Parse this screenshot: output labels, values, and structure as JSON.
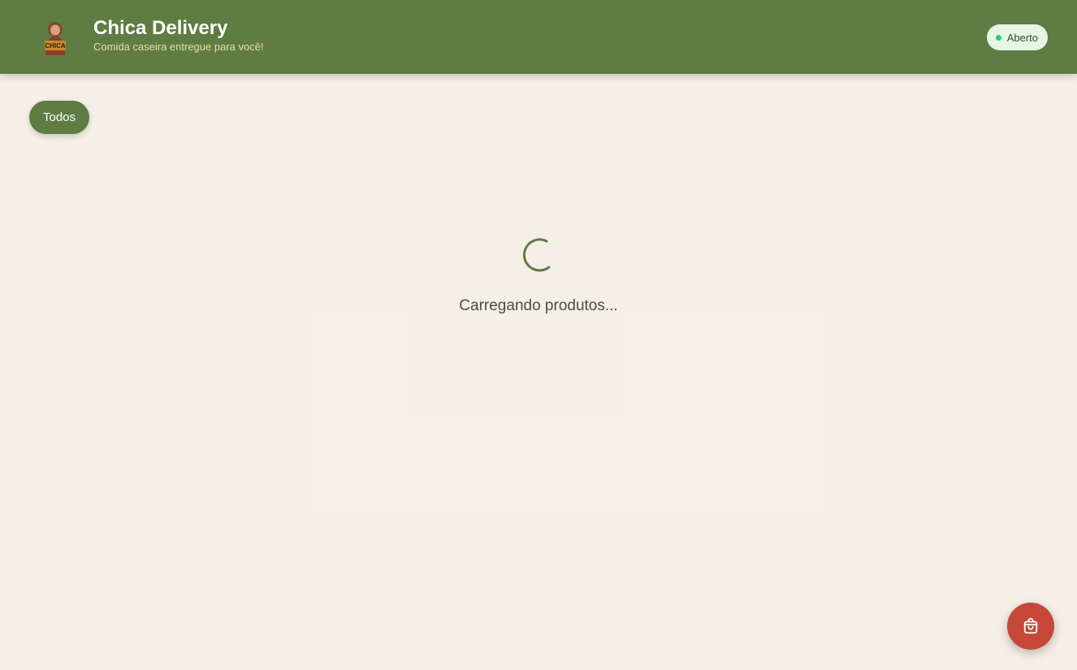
{
  "header": {
    "title": "Chica Delivery",
    "subtitle": "Comida caseira entregue para você!",
    "status": "Aberto",
    "status_color": "#2ecc71",
    "logo_icon": "chica-logo-icon"
  },
  "categories": [
    {
      "label": "Todos",
      "active": true
    }
  ],
  "loading": {
    "text": "Carregando produtos...",
    "icon": "spinner-icon"
  },
  "cart": {
    "icon": "shopping-bag-icon"
  },
  "colors": {
    "primary": "#5f7c43",
    "background": "#f4f0e7",
    "accent": "#c7473a"
  }
}
